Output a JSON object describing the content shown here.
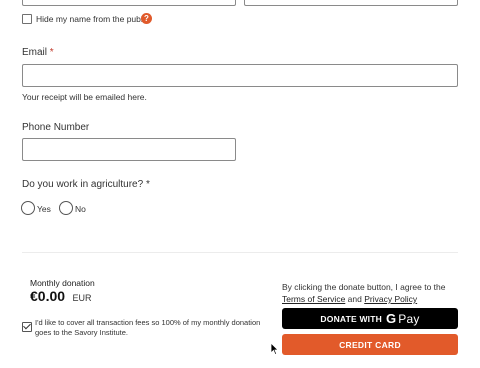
{
  "name_visibility": {
    "hide_name_label": "Hide my name from the public.",
    "help_glyph": "?"
  },
  "email": {
    "label": "Email",
    "required_mark": "*",
    "value": "",
    "hint": "Your receipt will be emailed here."
  },
  "phone": {
    "label": "Phone Number",
    "value": ""
  },
  "agriculture": {
    "question": "Do you work in agriculture?",
    "required_mark": "*",
    "options": [
      {
        "label": "Yes"
      },
      {
        "label": "No"
      }
    ]
  },
  "summary": {
    "frequency_label": "Monthly donation",
    "amount": "€0.00",
    "currency": "EUR",
    "cover_fees_label": "I'd like to cover all transaction fees so 100% of my monthly donation goes to the Savory Institute.",
    "cover_fees_checked": true
  },
  "consent": {
    "text_prefix": "By clicking the donate button, I agree to the",
    "terms_link": "Terms of Service",
    "and_text": "and",
    "privacy_link": "Privacy Policy"
  },
  "buttons": {
    "gpay_prefix": "DONATE WITH",
    "gpay_g": "G",
    "gpay_word": "Pay",
    "credit_card": "CREDIT CARD"
  },
  "colors": {
    "accent": "#e25a2a",
    "button_dark": "#000000"
  }
}
